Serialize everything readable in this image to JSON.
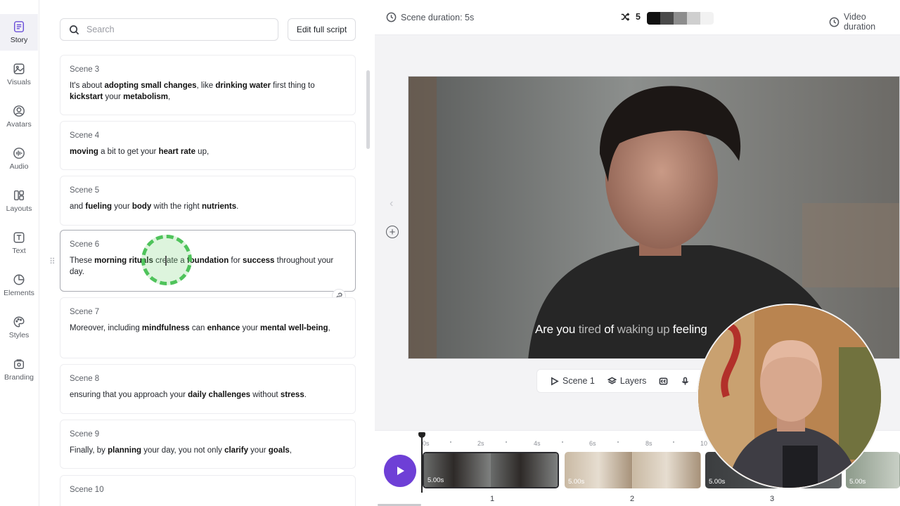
{
  "rail": [
    {
      "label": "Story",
      "icon": "story-icon",
      "active": true
    },
    {
      "label": "Visuals",
      "icon": "image-icon"
    },
    {
      "label": "Avatars",
      "icon": "avatar-icon"
    },
    {
      "label": "Audio",
      "icon": "audio-icon"
    },
    {
      "label": "Layouts",
      "icon": "layouts-icon"
    },
    {
      "label": "Text",
      "icon": "text-icon"
    },
    {
      "label": "Elements",
      "icon": "elements-icon"
    },
    {
      "label": "Styles",
      "icon": "palette-icon"
    },
    {
      "label": "Branding",
      "icon": "branding-icon"
    }
  ],
  "search": {
    "placeholder": "Search"
  },
  "edit_full_script": "Edit full script",
  "scenes": [
    {
      "title": "Scene 3",
      "text_html": "It's about <b>adopting small changes</b>, like <b>drinking water</b> first thing to <b>kickstart</b> your <b>metabolism</b>,"
    },
    {
      "title": "Scene 4",
      "text_html": "<b>moving</b> a bit to get your <b>heart rate</b> up,"
    },
    {
      "title": "Scene 5",
      "text_html": "and <b>fueling</b> your <b>body</b> with the right <b>nutrients</b>."
    },
    {
      "title": "Scene 6",
      "text_html": "These <b>morning rituals</b> create a <b>foundation</b> for <b>success</b> throughout your day.",
      "selected": true
    },
    {
      "title": "Scene 7",
      "text_html": "Moreover, including <b>mindfulness</b> can <b>enhance</b> your <b>mental well-being</b>,"
    },
    {
      "title": "Scene 8",
      "text_html": "ensuring that you approach your <b>daily challenges</b> without <b>stress</b>."
    },
    {
      "title": "Scene 9",
      "text_html": "Finally, by <b>planning</b> your day, you not only <b>clarify</b> your <b>goals</b>,"
    },
    {
      "title": "Scene 10",
      "text_html": ""
    }
  ],
  "topbar": {
    "scene_duration": "Scene duration: 5s",
    "shuffle_count": "5",
    "video_duration": "Video duration",
    "swatch_colors": [
      "#111111",
      "#4a4a4a",
      "#8d8d8d",
      "#cfcfcf",
      "#f2f2f2"
    ]
  },
  "subtitle": {
    "words": [
      {
        "t": "Are you",
        "dim": false
      },
      {
        "t": " tired",
        "dim": true
      },
      {
        "t": " of",
        "dim": false
      },
      {
        "t": " waking up",
        "dim": true
      },
      {
        "t": " feeling",
        "dim": false
      }
    ]
  },
  "scene_bar": {
    "scene": "Scene 1",
    "layers": "Layers"
  },
  "timeline": {
    "ruler": [
      "0s",
      "2s",
      "4s",
      "6s",
      "8s",
      "10"
    ],
    "clips": [
      {
        "duration": "5.00s",
        "number": "1",
        "active": true
      },
      {
        "duration": "5.00s",
        "number": "2"
      },
      {
        "duration": "5.00s",
        "number": "3"
      },
      {
        "duration": "5.00s",
        "number": ""
      }
    ]
  },
  "colors": {
    "accent": "#6e3fd6",
    "highlight_ring": "#4fc35b"
  }
}
